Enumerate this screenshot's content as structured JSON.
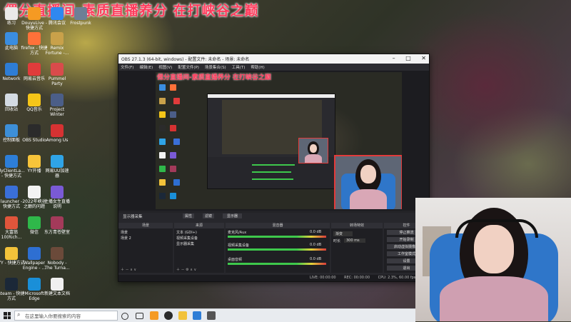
{
  "stream_title": "偲分直播间-素质直播养分  在打峡谷之巅",
  "desktop_icons": [
    {
      "label": "练习",
      "icon": "document-icon",
      "color": "#e9e9e9"
    },
    {
      "label": "DouyuLive - 快捷方式",
      "icon": "douyu-icon",
      "color": "#f59a23"
    },
    {
      "label": "腾讯会议",
      "icon": "meeting-icon",
      "color": "#2f88f0"
    },
    {
      "label": "Frostpunk",
      "icon": "game-icon",
      "color": "#6d7f96"
    },
    {
      "label": "此电脑",
      "icon": "computer-icon",
      "color": "#3a8de0"
    },
    {
      "label": "firefox - 快捷方式",
      "icon": "firefox-icon",
      "color": "#ff7139"
    },
    {
      "label": "Remix Fortune -...",
      "icon": "game-icon",
      "color": "#c9a14a"
    },
    {
      "label": "Network",
      "icon": "network-icon",
      "color": "#2e7dd6"
    },
    {
      "label": "网易云音乐",
      "icon": "music-icon",
      "color": "#e03b3b"
    },
    {
      "label": "Pummel Party",
      "icon": "game-icon",
      "color": "#d94b4b"
    },
    {
      "label": "回收站",
      "icon": "recycle-bin-icon",
      "color": "#d4dbe3"
    },
    {
      "label": "QQ音乐",
      "icon": "qq-music-icon",
      "color": "#f5c518"
    },
    {
      "label": "Project Winter",
      "icon": "game-icon",
      "color": "#4b5e88"
    },
    {
      "label": "控制面板",
      "icon": "control-panel-icon",
      "color": "#3d8fd8"
    },
    {
      "label": "OBS Studio",
      "icon": "obs-icon",
      "color": "#2b2b2b"
    },
    {
      "label": "Among Us",
      "icon": "amongus-icon",
      "color": "#d63232"
    },
    {
      "label": "dyClientLa... - 快捷方式",
      "icon": "douyu-icon",
      "color": "#2d7ed8"
    },
    {
      "label": "YY开播",
      "icon": "yy-icon",
      "color": "#f7c43a"
    },
    {
      "label": "网易UU加速器",
      "icon": "uu-icon",
      "color": "#2fa4e7"
    },
    {
      "label": "launcher - 快捷方式",
      "icon": "launcher-icon",
      "color": "#3a6fd8"
    },
    {
      "label": "2022年峡谷之巅的问题",
      "icon": "document-icon",
      "color": "#f3f3f3"
    },
    {
      "label": "主播女生直播说明",
      "icon": "document-icon",
      "color": "#7a5ad6"
    },
    {
      "label": "大富翁10(Rich...",
      "icon": "game-icon",
      "color": "#e0553b"
    },
    {
      "label": "微信",
      "icon": "wechat-icon",
      "color": "#2fb84a"
    },
    {
      "label": "东方青苍壁室",
      "icon": "image-icon",
      "color": "#a33a5a"
    },
    {
      "label": "YY - 快捷方式",
      "icon": "yy-icon",
      "color": "#f2c23a"
    },
    {
      "label": "Wallpaper Engine - ...",
      "icon": "wallpaper-icon",
      "color": "#2e6fd2"
    },
    {
      "label": "Nobody - The Turna...",
      "icon": "game-icon",
      "color": "#6b4a3a"
    },
    {
      "label": "steam - 快捷方式",
      "icon": "steam-icon",
      "color": "#1b2838"
    },
    {
      "label": "Microsoft Edge",
      "icon": "edge-icon",
      "color": "#1a8fd8"
    },
    {
      "label": "新建文本文档",
      "icon": "document-icon",
      "color": "#f0f0f0"
    }
  ],
  "obs": {
    "title": "OBS 27.1.3 (64-bit, windows) - 配置文件: 未命名 - 场景: 未命名",
    "menu": [
      "文件(F)",
      "编辑(E)",
      "视图(V)",
      "配置文件(P)",
      "场景集合(S)",
      "工具(T)",
      "帮助(H)"
    ],
    "preview_overlay_title": "偲分直播间-素质直播养分  在打峡谷之巅",
    "source_bar": {
      "source_name": "显示器采集",
      "properties": "属性",
      "filters": "滤镜",
      "screen": "显示器"
    },
    "docks": {
      "scenes_title": "场景",
      "scenes": [
        "场景",
        "场景 2"
      ],
      "sources_title": "来源",
      "sources": [
        "文本 (GDI+)",
        "视频采集设备",
        "显示器采集"
      ],
      "mixer_title": "混音器",
      "mixer": [
        {
          "name": "麦克风/Aux",
          "level": "0.0 dB"
        },
        {
          "name": "视频采集设备",
          "level": "0.0 dB"
        },
        {
          "name": "桌面音频",
          "level": "0.0 dB"
        }
      ],
      "transitions_title": "转场特效",
      "transition": "渐变",
      "duration_label": "时长",
      "duration": "300 ms",
      "controls_title": "控件",
      "controls": [
        "停止推流",
        "开始录制",
        "启动虚拟摄像机",
        "工作室模式",
        "设置",
        "退出"
      ]
    },
    "status": {
      "live": "LIVE: 00:00:00",
      "rec": "REC: 00:00:00",
      "cpu": "CPU: 2.3%, 60.00 fps"
    }
  },
  "taskbar": {
    "search_placeholder": "在这里输入你要搜索的内容"
  }
}
